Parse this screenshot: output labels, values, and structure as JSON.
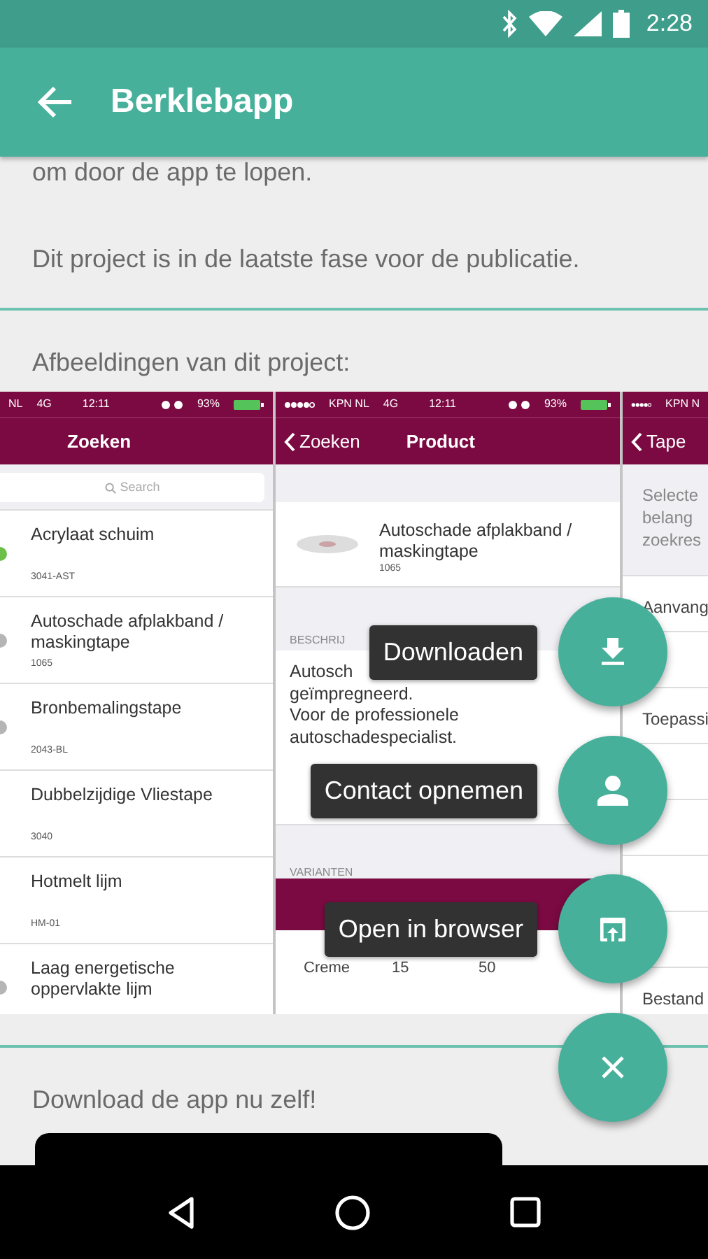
{
  "status_bar": {
    "time": "2:28"
  },
  "app_bar": {
    "title": "Berklebapp"
  },
  "content": {
    "intro_tail": "om door de app te lopen.",
    "phase_text": "Dit project is in de laatste fase voor de publicatie.",
    "images_heading": "Afbeeldingen van dit project:",
    "download_heading": "Download de app nu zelf!"
  },
  "screenshots": [
    {
      "kind": "search_list",
      "status": [
        "NL",
        "4G",
        "12:11",
        "93%"
      ],
      "title": "Zoeken",
      "search_placeholder": "Search",
      "items": [
        {
          "name": "Acrylaat schuim",
          "code": "3041-AST",
          "color": "#6cc04a"
        },
        {
          "name": "Autoschade afplakband / maskingtape",
          "code": "1065",
          "color": "#b5b5b5"
        },
        {
          "name": "Bronbemalingstape",
          "code": "2043-BL",
          "color": "#b5b5b5"
        },
        {
          "name": "Dubbelzijdige Vliestape",
          "code": "3040"
        },
        {
          "name": "Hotmelt lijm",
          "code": "HM-01"
        },
        {
          "name": "Laag energetische oppervlakte lijm",
          "color": "#b5b5b5"
        }
      ]
    },
    {
      "kind": "product",
      "status": [
        "KPN NL",
        "4G",
        "12:11",
        "93%"
      ],
      "back": "Zoeken",
      "title": "Product",
      "product_name": "Autoschade afplakband / maskingtape",
      "product_code": "1065",
      "section_label": "BESCHRIJ",
      "description": [
        "Autosch",
        "geïmpregneerd.",
        "Voor de professionele",
        "autoschadespecialist."
      ],
      "variants_label": "VARIANTEN",
      "variant_row": [
        "Creme",
        "15",
        "50"
      ]
    },
    {
      "kind": "filter_list",
      "status": [
        "KPN N"
      ],
      "back": "Tape",
      "intro_lines": [
        "Selecte",
        "belang",
        "zoekres"
      ],
      "items": [
        "Aanvang",
        "Toepassi",
        "Bestand"
      ]
    }
  ],
  "fab": {
    "expanded": true,
    "actions": [
      {
        "label": "Downloaden",
        "kind": "download"
      },
      {
        "label": "Contact opnemen",
        "kind": "contact"
      },
      {
        "label": "Open in browser",
        "kind": "browser"
      }
    ]
  }
}
